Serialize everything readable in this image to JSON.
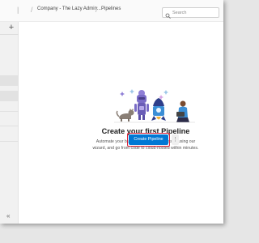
{
  "header": {
    "breadcrumbs": [
      {
        "label": "Company - The Lazy Admin..."
      },
      {
        "label": "Pipelines"
      }
    ],
    "search": {
      "placeholder": "Search",
      "icon": "search-icon"
    }
  },
  "sidebar": {
    "add_label": "+",
    "collapse_label": "«"
  },
  "main": {
    "title": "Create your first Pipeline",
    "description": "Automate your build and release processes using our wizard, and go from code to cloud-hosted within minutes.",
    "create_button_label": "Create Pipeline",
    "more_label": "⋮"
  },
  "colors": {
    "accent": "#0078d4",
    "highlight_frame": "#d9223a"
  }
}
